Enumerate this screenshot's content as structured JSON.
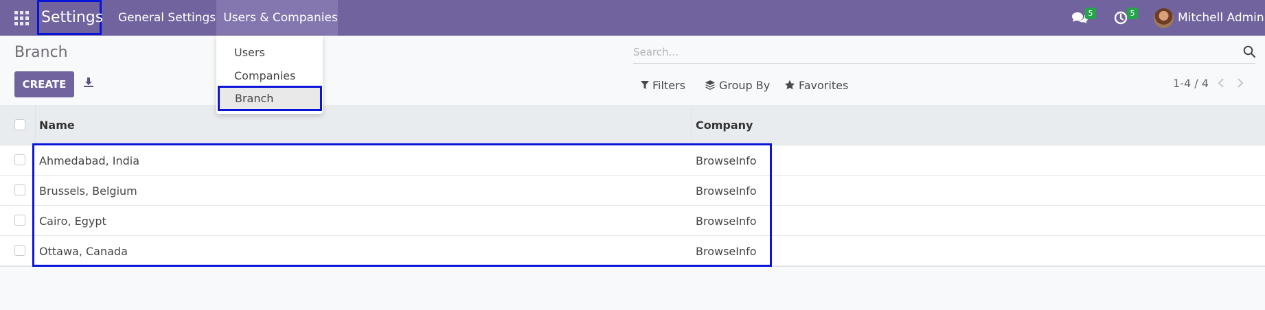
{
  "navbar": {
    "brand": "Settings",
    "menu": [
      {
        "label": "General Settings"
      },
      {
        "label": "Users & Companies"
      }
    ],
    "messages_count": "5",
    "activities_count": "5",
    "user_name": "Mitchell Admin"
  },
  "dropdown": {
    "items": [
      {
        "label": "Users"
      },
      {
        "label": "Companies"
      },
      {
        "label": "Branch"
      }
    ]
  },
  "control_panel": {
    "title": "Branch",
    "create_label": "CREATE",
    "search_placeholder": "Search...",
    "filters_label": "Filters",
    "groupby_label": "Group By",
    "favorites_label": "Favorites",
    "pager": "1-4 / 4"
  },
  "table": {
    "columns": [
      "Name",
      "Company"
    ],
    "rows": [
      {
        "name": "Ahmedabad, India",
        "company": "BrowseInfo"
      },
      {
        "name": "Brussels, Belgium",
        "company": "BrowseInfo"
      },
      {
        "name": "Cairo, Egypt",
        "company": "BrowseInfo"
      },
      {
        "name": "Ottawa, Canada",
        "company": "BrowseInfo"
      }
    ]
  },
  "colors": {
    "navbar": "#71639e",
    "active_menu": "#8477af",
    "highlight": "#0a14d8",
    "badge": "#22a649"
  }
}
